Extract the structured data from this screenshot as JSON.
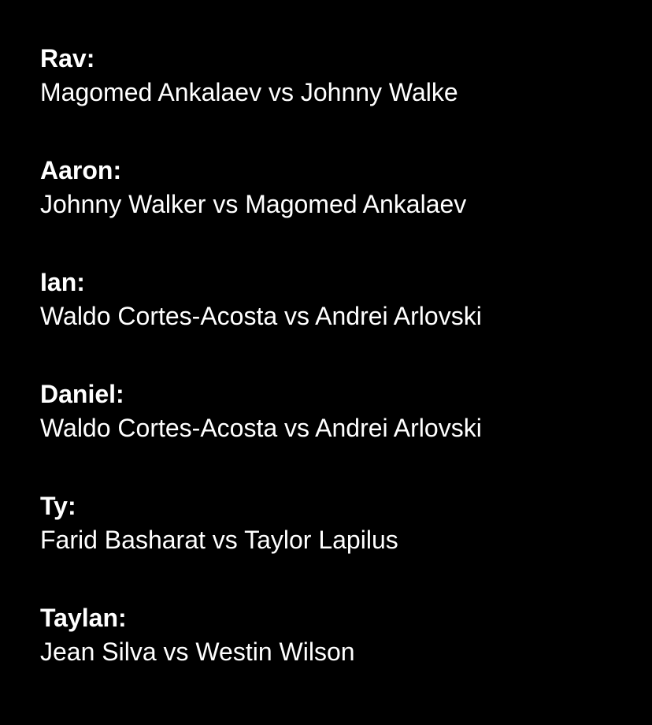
{
  "picks": [
    {
      "name": "Rav:",
      "matchup": "Magomed Ankalaev vs Johnny Walke"
    },
    {
      "name": "Aaron:",
      "matchup": "Johnny Walker vs Magomed Ankalaev"
    },
    {
      "name": "Ian:",
      "matchup": "Waldo Cortes-Acosta vs Andrei Arlovski"
    },
    {
      "name": "Daniel:",
      "matchup": "Waldo Cortes-Acosta vs Andrei Arlovski"
    },
    {
      "name": "Ty:",
      "matchup": "Farid Basharat vs Taylor Lapilus"
    },
    {
      "name": "Taylan:",
      "matchup": "Jean Silva vs Westin Wilson"
    }
  ],
  "colors": {
    "background": "#000000",
    "text": "#ffffff"
  }
}
